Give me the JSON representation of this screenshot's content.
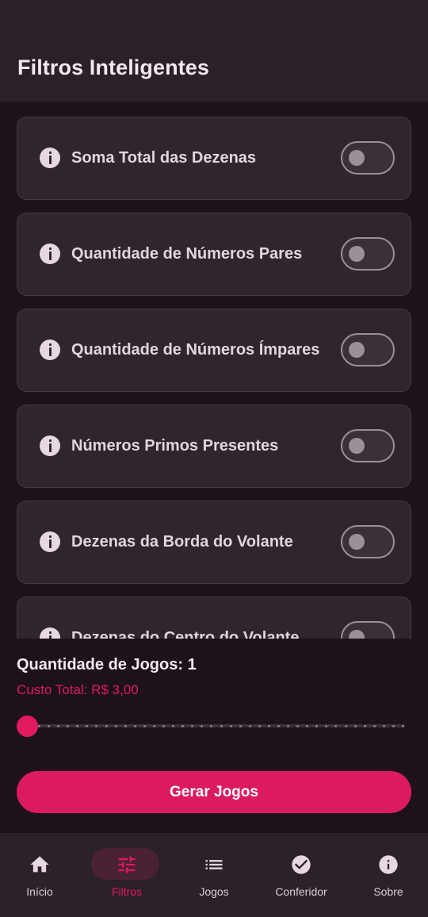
{
  "header": {
    "title": "Filtros Inteligentes"
  },
  "filters": [
    {
      "label": "Soma Total das Dezenas",
      "enabled": false
    },
    {
      "label": "Quantidade de Números Pares",
      "enabled": false
    },
    {
      "label": "Quantidade de Números Ímpares",
      "enabled": false
    },
    {
      "label": "Números Primos Presentes",
      "enabled": false
    },
    {
      "label": "Dezenas da Borda do Volante",
      "enabled": false
    },
    {
      "label": "Dezenas do Centro do Volante",
      "enabled": false
    }
  ],
  "panel": {
    "quantity_label": "Quantidade de Jogos: 1",
    "cost_label": "Custo Total: R$ 3,00",
    "slider_value": 1,
    "slider_min": 1,
    "slider_max": 40,
    "generate_label": "Gerar Jogos"
  },
  "nav": [
    {
      "label": "Início",
      "icon": "home-icon",
      "active": false
    },
    {
      "label": "Filtros",
      "icon": "tune-icon",
      "active": true
    },
    {
      "label": "Jogos",
      "icon": "list-icon",
      "active": false
    },
    {
      "label": "Conferidor",
      "icon": "check-circle-icon",
      "active": false
    },
    {
      "label": "Sobre",
      "icon": "info-icon",
      "active": false
    }
  ],
  "colors": {
    "accent": "#e2195f",
    "background": "#1d1219",
    "card": "#2f252d",
    "header": "#2a2028",
    "nav_bar": "#2c2029"
  }
}
